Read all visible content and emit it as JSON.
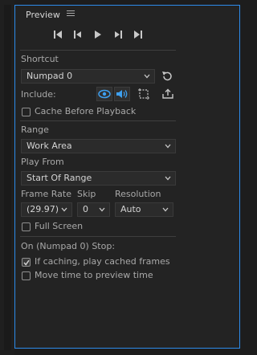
{
  "panel": {
    "title": "Preview"
  },
  "shortcut": {
    "label": "Shortcut",
    "value": "Numpad 0"
  },
  "include": {
    "label": "Include:"
  },
  "cache_before_playback": {
    "label": "Cache Before Playback",
    "checked": false
  },
  "range": {
    "label": "Range",
    "value": "Work Area"
  },
  "play_from": {
    "label": "Play From",
    "value": "Start Of Range"
  },
  "frame_rate": {
    "label": "Frame Rate",
    "value": "(29.97)"
  },
  "skip": {
    "label": "Skip",
    "value": "0"
  },
  "resolution": {
    "label": "Resolution",
    "value": "Auto"
  },
  "full_screen": {
    "label": "Full Screen",
    "checked": false
  },
  "stop": {
    "label": "On (Numpad 0) Stop:"
  },
  "if_caching": {
    "label": "If caching, play cached frames",
    "checked": true
  },
  "move_time": {
    "label": "Move time to preview time",
    "checked": false
  },
  "colors": {
    "accent": "#2d8ceb",
    "active_icon": "#3ea0f0"
  }
}
